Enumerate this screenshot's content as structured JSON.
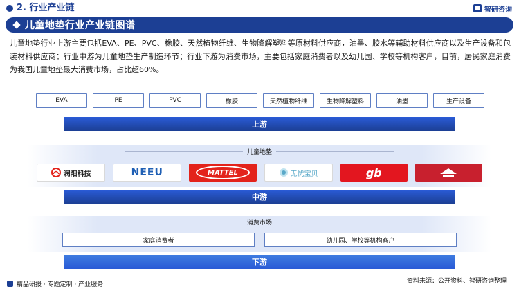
{
  "header": {
    "section": "2. 行业产业链",
    "brand": "智研咨询"
  },
  "title": "儿童地垫行业产业链图谱",
  "intro": "儿童地垫行业上游主要包括EVA、PE、PVC、橡胶、天然植物纤维、生物降解塑料等原材料供应商，油墨、胶水等辅助材料供应商以及生产设备和包装材料供应商；行业中游为儿童地垫生产制造环节；行业下游为消费市场，主要包括家庭消费者以及幼儿园、学校等机构客户，目前，居民家庭消费为我国儿童地垫最大消费市场，占比超60%。",
  "upstream": {
    "items": [
      "EVA",
      "PE",
      "PVC",
      "橡胶",
      "天然植物纤维",
      "生物降解塑料",
      "油墨",
      "生产设备"
    ],
    "bar": "上游"
  },
  "midstream": {
    "label": "儿童地垫",
    "logos": [
      {
        "name": "润阳科技",
        "icon": "runyang-logo"
      },
      {
        "name": "NEEU",
        "icon": "neeu-logo"
      },
      {
        "name": "MATTEL",
        "icon": "mattel-logo"
      },
      {
        "name": "无忧宝贝",
        "icon": "wuyou-baobei-logo"
      },
      {
        "name": "gb",
        "icon": "gb-logo"
      },
      {
        "name": "",
        "icon": "brand-logo"
      }
    ],
    "bar": "中游"
  },
  "downstream": {
    "label": "消费市场",
    "items": [
      "家庭消费者",
      "幼儿园、学校等机构客户"
    ],
    "bar": "下游"
  },
  "footer": {
    "left": "精品研报 · 专题定制 · 产业服务",
    "right_line1": "资料来源：公开资料、智研咨询整理"
  },
  "colors": {
    "primary": "#1c3f94",
    "bar": "#2a5bd6",
    "box_border": "#5f7fc4"
  }
}
